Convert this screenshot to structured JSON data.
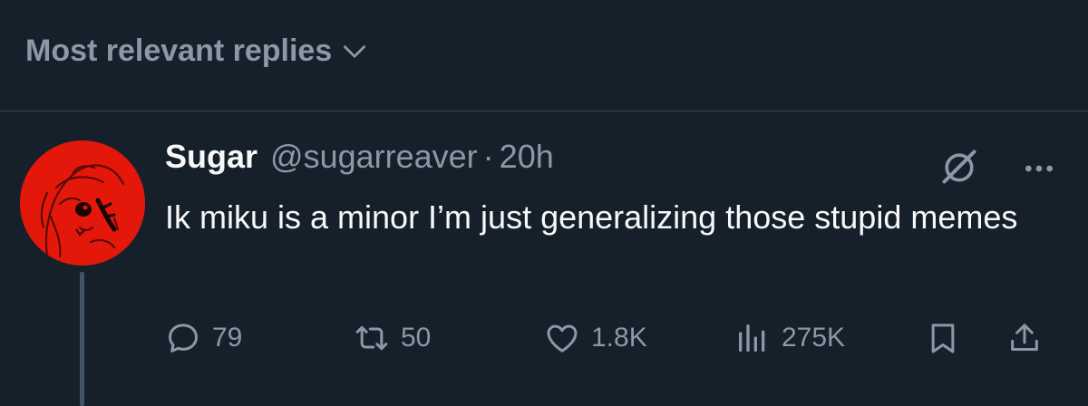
{
  "sort": {
    "label": "Most relevant replies",
    "icon": "chevron-down-icon"
  },
  "reply": {
    "author": {
      "display_name": "Sugar",
      "handle": "@sugarreaver",
      "avatar_color": "#e3170a"
    },
    "separator": "·",
    "time": "20h",
    "text": "Ik miku is a minor I’m just generalizing those stupid memes",
    "metrics": {
      "replies": "79",
      "retweets": "50",
      "likes": "1.8K",
      "views": "275K"
    },
    "icons": {
      "grok": "grok-icon",
      "more": "more-icon",
      "reply": "reply-icon",
      "retweet": "retweet-icon",
      "like": "heart-icon",
      "views": "views-icon",
      "bookmark": "bookmark-icon",
      "share": "share-icon"
    }
  },
  "colors": {
    "background": "#15202b",
    "primary_text": "#f7f9f9",
    "secondary_text": "#8b98a5",
    "divider": "#38444d"
  }
}
